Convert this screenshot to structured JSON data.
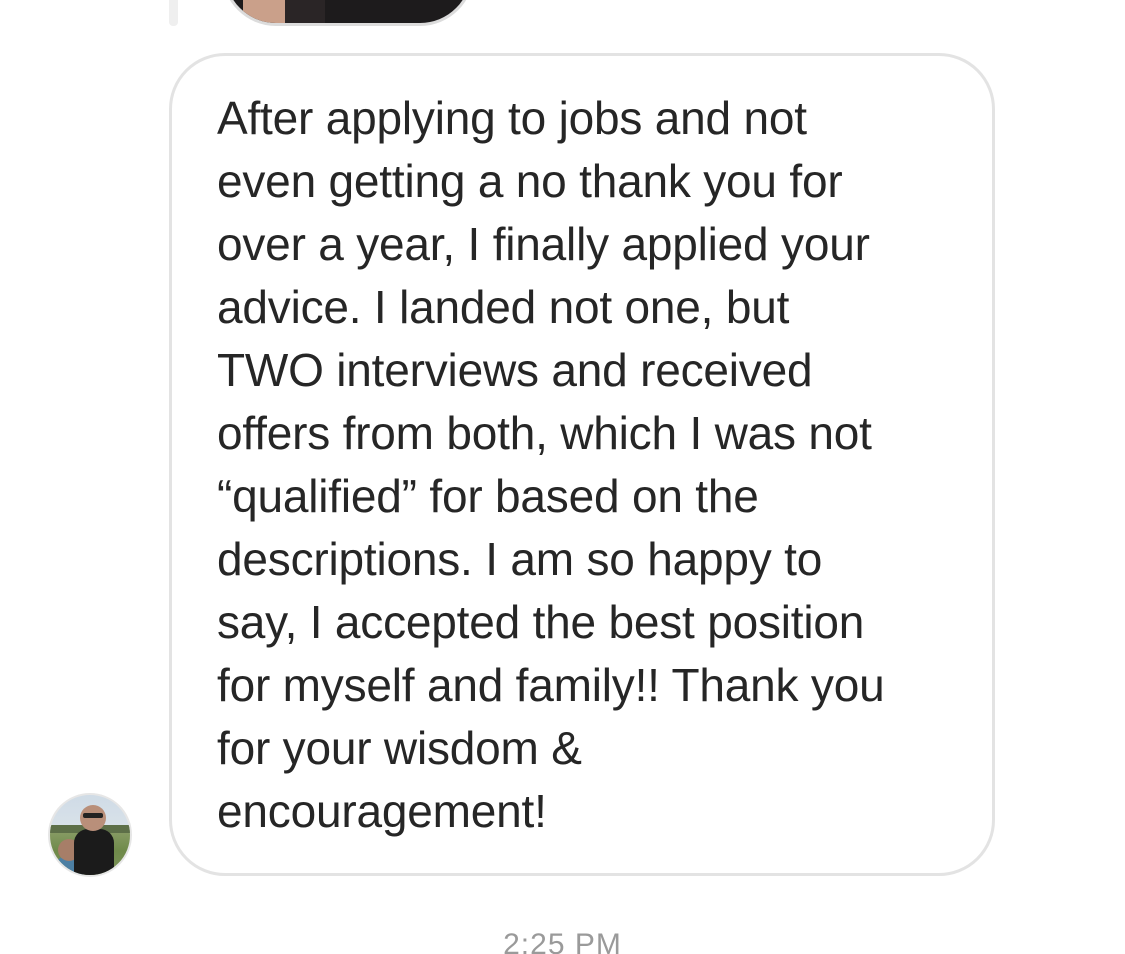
{
  "conversation": {
    "message": {
      "text": "After applying to jobs and not\neven getting a no thank you for\nover a year, I finally applied your\nadvice. I landed not one, but\nTWO interviews and received\noffers from both, which I was not\n“qualified” for based on the\ndescriptions. I am so happy to\nsay, I accepted the best position\nfor myself and family!! Thank you\nfor your wisdom &\nencouragement!"
    },
    "timestamp": "2:25 PM"
  },
  "icons": {
    "avatar": "sender-avatar-photo",
    "previous_media": "shared-photo-thumbnail"
  },
  "colors": {
    "bubble_border": "#e3e3e3",
    "text": "#262626",
    "timestamp": "#9a9a9a",
    "background": "#ffffff"
  }
}
